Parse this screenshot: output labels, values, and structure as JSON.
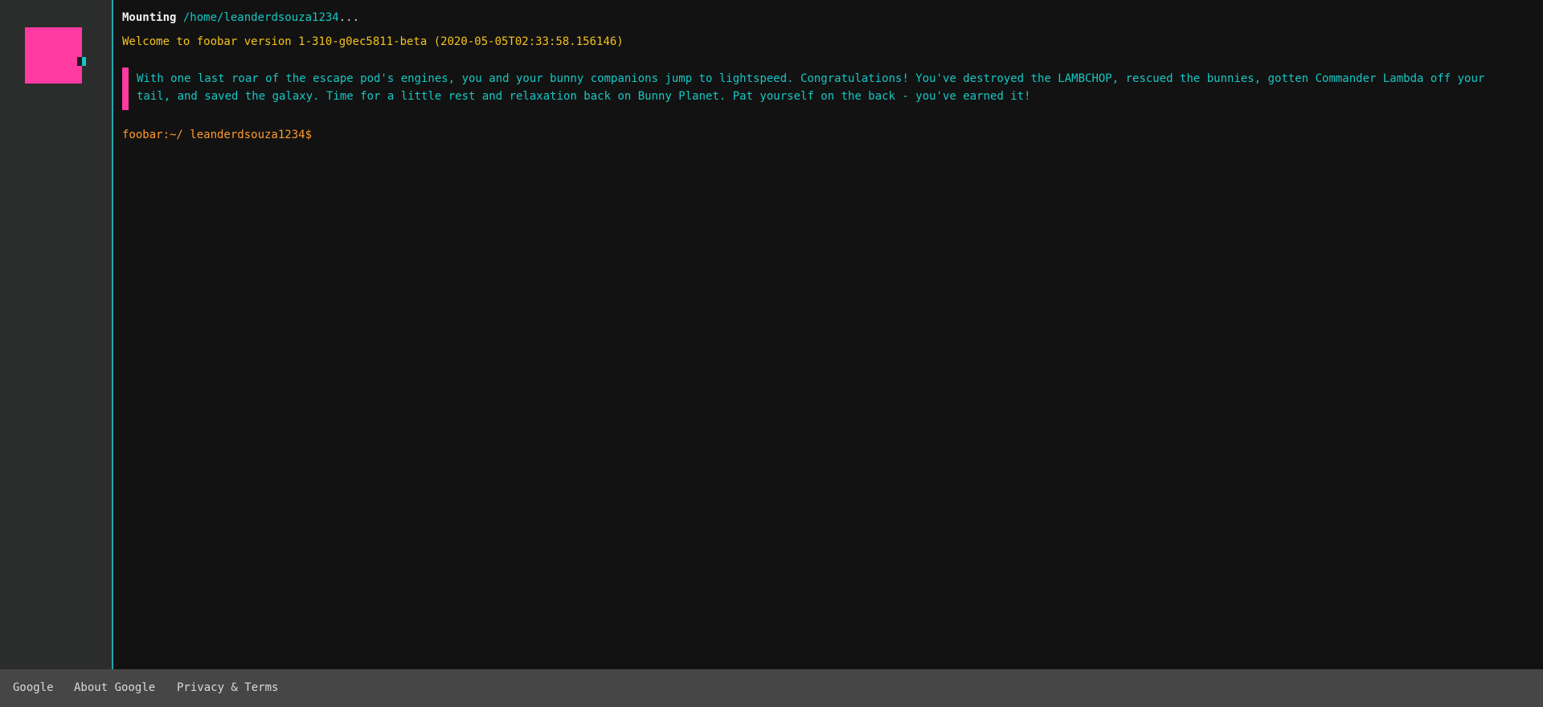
{
  "sidebar": {
    "avatar_icon": "pink-square-avatar-icon",
    "avatar_color": "#ff3aa0",
    "accent_color": "#16c7c4"
  },
  "terminal": {
    "mount": {
      "word": "Mounting",
      "path": "/home/leanderdsouza1234",
      "suffix": "..."
    },
    "welcome": "Welcome to foobar version 1-310-g0ec5811-beta (2020-05-05T02:33:58.156146)",
    "story": "With one last roar of the escape pod's engines, you and your bunny companions jump to lightspeed. Congratulations! You've destroyed the LAMBCHOP, rescued the bunnies, gotten Commander Lambda off your tail, and saved the galaxy. Time for a little rest and relaxation back on Bunny Planet. Pat yourself on the back - you've earned it!",
    "prompt": "foobar:~/ leanderdsouza1234$",
    "colors": {
      "background": "#121212",
      "cyan": "#16c7c4",
      "yellow": "#f5c21b",
      "orange": "#ff9a2e",
      "pink": "#ff3aa0"
    }
  },
  "footer": {
    "links": [
      {
        "label": "Google"
      },
      {
        "label": "About Google"
      },
      {
        "label": "Privacy & Terms"
      }
    ],
    "background": "#464646"
  }
}
